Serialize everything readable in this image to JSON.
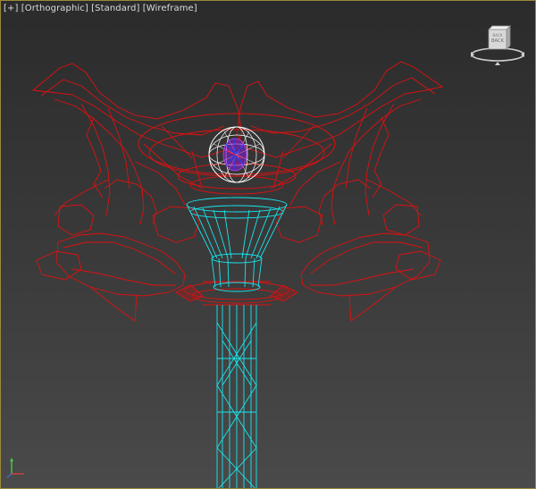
{
  "viewport": {
    "label_parts": [
      "[+]",
      "[Orthographic]",
      "[Standard]",
      "[Wireframe]"
    ]
  },
  "viewcube": {
    "face_label_top": "BACK",
    "face_label": "BACK"
  },
  "colors": {
    "ornament_wire": "#e01010",
    "shaft_wire": "#18e6ee",
    "orb_wire": "#ffffff",
    "orb_core": "#8a1ed8",
    "background_top": "#2b2b2b",
    "background_bottom": "#4a4a4a"
  }
}
